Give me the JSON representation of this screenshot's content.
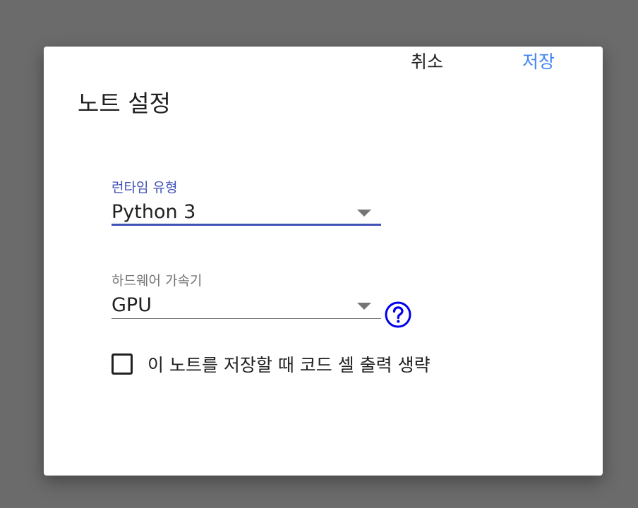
{
  "dialog": {
    "title": "노트 설정",
    "runtime": {
      "label": "런타임 유형",
      "value": "Python 3"
    },
    "hardware": {
      "label": "하드웨어 가속기",
      "value": "GPU",
      "help_icon": "question-circle-icon"
    },
    "omit_output": {
      "label": "이 노트를 저장할 때 코드 셀 출력 생략",
      "checked": false
    },
    "buttons": {
      "cancel": "취소",
      "save": "저장"
    }
  },
  "colors": {
    "backdrop": "#6b6b6b",
    "accent": "#3f51b5",
    "save_button": "#4285f4",
    "help_icon": "#0000ee"
  }
}
